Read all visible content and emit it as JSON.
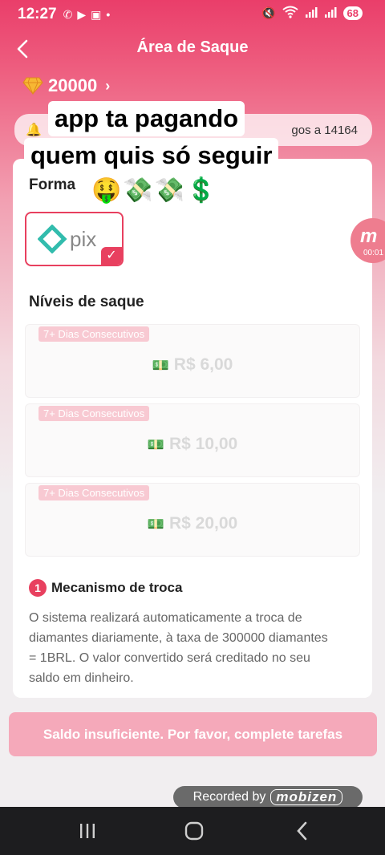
{
  "status_bar": {
    "time": "12:27",
    "battery": "68",
    "icons": [
      "whatsapp-icon",
      "youtube-icon",
      "screenshot-icon",
      "dot-icon",
      "mute-icon",
      "wifi-icon",
      "signal-icon",
      "signal-icon"
    ]
  },
  "header": {
    "title": "Área de Saque"
  },
  "balance": {
    "diamonds": "20000"
  },
  "notice": {
    "text": "gos a 14164"
  },
  "caption": {
    "line1": "app ta pagando",
    "line2": "quem quis só seguir",
    "line3": "🤑💸💸💲"
  },
  "method": {
    "label": "Forma",
    "selected": "pix"
  },
  "levels": {
    "title": "Níveis de saque",
    "items": [
      {
        "tag": "7+ Dias Consecutivos",
        "amount": "R$ 6,00"
      },
      {
        "tag": "7+ Dias Consecutivos",
        "amount": "R$ 10,00"
      },
      {
        "tag": "7+ Dias Consecutivos",
        "amount": "R$ 20,00"
      }
    ]
  },
  "mechanism": {
    "number": "1",
    "title": "Mecanismo de troca",
    "body": "O sistema realizará automaticamente a troca de diamantes diariamente, à taxa de 300000 diamantes = 1BRL. O valor convertido será creditado no seu saldo em dinheiro."
  },
  "withdraw_button": {
    "label": "Saldo insuficiente. Por favor, complete tarefas"
  },
  "floating_recorder": {
    "time": "00:01"
  },
  "recorded_badge": {
    "text": "Recorded by",
    "brand": "mobizen"
  },
  "colors": {
    "primary": "#e8405f",
    "header": "#ea3e6a",
    "disabled_button": "#f5a9ba"
  }
}
